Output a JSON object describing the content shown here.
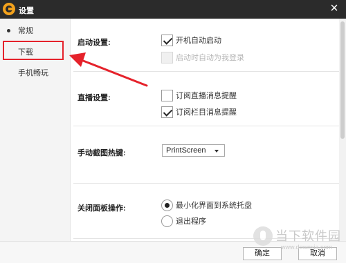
{
  "window": {
    "title": "设置"
  },
  "sidebar": {
    "items": [
      {
        "label": "常规",
        "active": true
      },
      {
        "label": "下载",
        "active": false
      },
      {
        "label": "手机畅玩",
        "active": false
      }
    ]
  },
  "sections": {
    "startup": {
      "label": "启动设置:",
      "options": [
        {
          "label": "开机自动启动",
          "checked": true,
          "disabled": false
        },
        {
          "label": "启动时自动为我登录",
          "checked": false,
          "disabled": true
        }
      ]
    },
    "live": {
      "label": "直播设置:",
      "options": [
        {
          "label": "订阅直播消息提醒",
          "checked": false,
          "disabled": false
        },
        {
          "label": "订阅栏目消息提醒",
          "checked": true,
          "disabled": false
        }
      ]
    },
    "screenshot": {
      "label": "手动截图热键:",
      "hotkey_value": "PrintScreen"
    },
    "close_panel": {
      "label": "关闭面板操作:",
      "options": [
        {
          "label": "最小化界面到系统托盘",
          "selected": true
        },
        {
          "label": "退出程序",
          "selected": false
        }
      ]
    }
  },
  "footer": {
    "ok_label": "确定",
    "cancel_label": "取消"
  },
  "annotation": {
    "highlight_color": "#e5222b"
  },
  "watermark": {
    "text": "当下软件园",
    "url": "www.downxia.com"
  },
  "colors": {
    "titlebar": "#2b2b2b",
    "logo": "#f4a21c"
  }
}
